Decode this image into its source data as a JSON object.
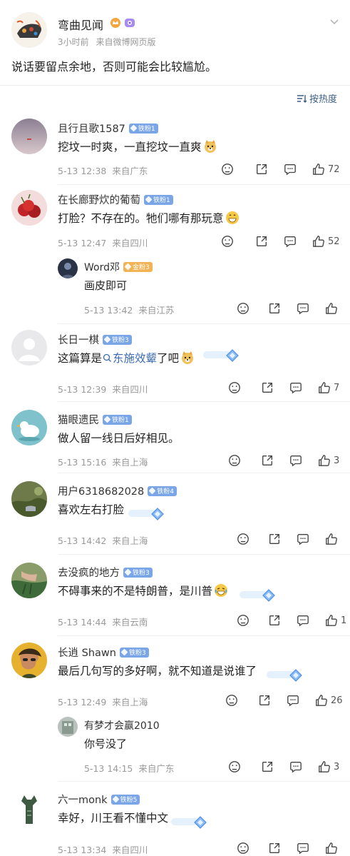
{
  "post": {
    "author": "弯曲见闻",
    "time": "3小时前",
    "source": "来自微博网页版",
    "text": "说话要留点余地，否则可能会比较尴尬。"
  },
  "sort": {
    "label": "按热度"
  },
  "comments": [
    {
      "name": "且行且歌1587",
      "badge": "铁粉1",
      "text": "挖坟一时爽，一直挖坟一直爽",
      "date": "5-13 12:38",
      "location": "来自广东",
      "likes": "72"
    },
    {
      "name": "在长廊野炊的葡萄",
      "badge": "铁粉1",
      "text": "打脸？不存在的。牠们哪有那玩意",
      "date": "5-13 12:47",
      "location": "来自四川",
      "likes": "52",
      "reply": {
        "name": "Word邓",
        "badge": "金粉3",
        "text": "画皮即可",
        "date": "5-13 13:42",
        "location": "来自江苏"
      }
    },
    {
      "name": "长日一棋",
      "badge": "铁粉3",
      "text_before": "这篇算是",
      "link": "东施效颦",
      "text_after": "了吧",
      "date": "5-13 12:39",
      "location": "来自四川",
      "likes": "7"
    },
    {
      "name": "猫眼遗民",
      "badge": "铁粉1",
      "text": "做人留一线日后好相见。",
      "date": "5-13 15:16",
      "location": "来自上海",
      "likes": "3"
    },
    {
      "name": "用户6318682028",
      "badge": "铁粉4",
      "text": "喜欢左右打脸",
      "date": "5-13 14:42",
      "location": "来自上海",
      "likes": ""
    },
    {
      "name": "去没疯的地方",
      "badge": "铁粉3",
      "text": "不碍事来的不是特朗普，是川普",
      "date": "5-13 14:44",
      "location": "来自云南",
      "likes": "1"
    },
    {
      "name": "长逍 Shawn",
      "badge": "铁粉3",
      "text": "最后几句写的多好啊，就不知道是说谁了",
      "date": "5-13 12:49",
      "location": "来自上海",
      "likes": "26",
      "reply": {
        "name": "有梦才会赢2010",
        "text": "你号没了",
        "date": "5-13 14:15",
        "location": "来自广东",
        "likes": "3"
      }
    },
    {
      "name": "六一monk",
      "badge": "铁粉5",
      "text": "幸好，川王看不懂中文",
      "date": "5-13 13:34",
      "location": "来自四川",
      "likes": ""
    }
  ],
  "colors": {
    "link": "#3c6bb3",
    "fan_badge": "#7aa6e8",
    "gold_badge": "#f2b355",
    "meta": "#9a9a9a"
  }
}
